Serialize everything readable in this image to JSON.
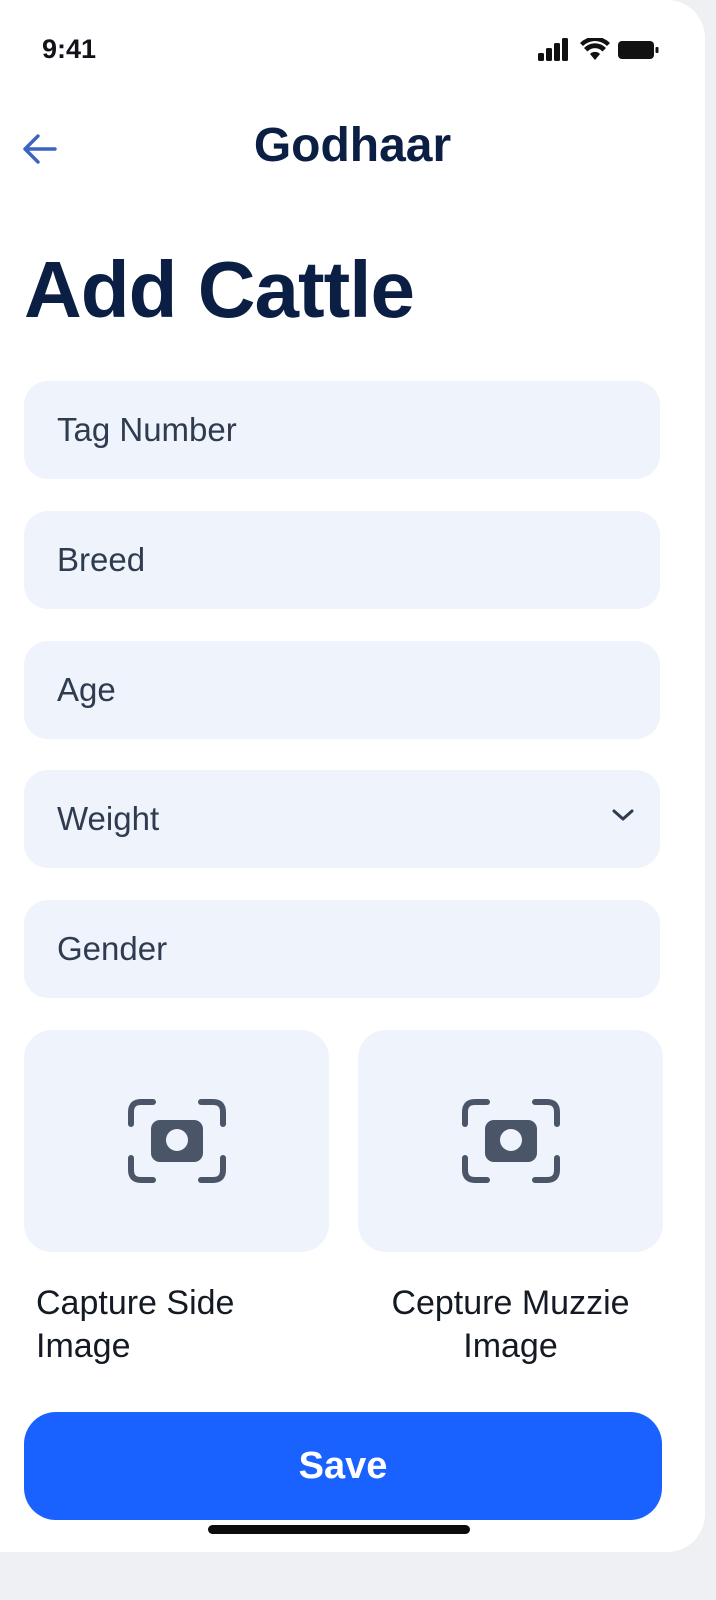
{
  "status_bar": {
    "time": "9:41"
  },
  "header": {
    "app_title": "Godhaar",
    "back_icon": "arrow-left-icon"
  },
  "page": {
    "title": "Add Cattle"
  },
  "form": {
    "tag_number": {
      "placeholder": "Tag Number"
    },
    "breed": {
      "placeholder": "Breed"
    },
    "age": {
      "placeholder": "Age"
    },
    "weight": {
      "placeholder": "Weight",
      "icon": "chevron-down-icon"
    },
    "gender": {
      "placeholder": "Gender"
    }
  },
  "capture": {
    "side": {
      "label": "Capture Side Image",
      "icon": "camera-scan-icon"
    },
    "muzzle": {
      "label": "Cepture Muzzie Image",
      "icon": "camera-scan-icon"
    }
  },
  "actions": {
    "save_label": "Save"
  },
  "colors": {
    "primary": "#1a62ff",
    "heading": "#0b1f44",
    "field_bg": "#eef3fc",
    "icon": "#4a5668",
    "back_arrow": "#3b63c4"
  }
}
